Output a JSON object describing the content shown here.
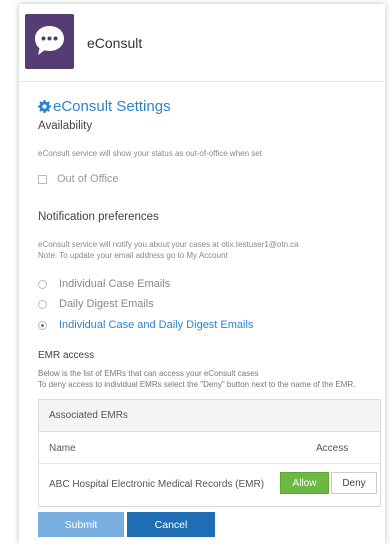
{
  "header": {
    "app_title": "eConsult",
    "logo_icon": "chat-bubble-icon",
    "logo_color": "#553c73"
  },
  "settings": {
    "title": "eConsult Settings",
    "title_icon": "gear-icon",
    "title_color": "#2e84c8"
  },
  "availability": {
    "heading": "Availability",
    "description": "eConsult service will show your status as out-of-office when set",
    "out_of_office_label": "Out of Office",
    "out_of_office_checked": false
  },
  "notifications": {
    "heading": "Notification preferences",
    "description_line1": "eConsult service will notify you about your cases at otix.testuser1@otn.ca",
    "description_line2": "Note: To update your email address go to My Account",
    "options": [
      {
        "label": "Individual Case Emails",
        "selected": false
      },
      {
        "label": "Daily Digest Emails",
        "selected": false
      },
      {
        "label": "Individual Case and Daily Digest Emails",
        "selected": true
      }
    ]
  },
  "emr": {
    "heading": "EMR access",
    "description_line1": "Below is the list of EMRs that can access your eConsult cases",
    "description_line2": "To deny access to individual EMRs select the \"Deny\" button next to the name of the EMR.",
    "table_title": "Associated EMRs",
    "col_name": "Name",
    "col_access": "Access",
    "rows": [
      {
        "name": "ABC Hospital Electronic Medical Records (EMR)",
        "allow_label": "Allow",
        "deny_label": "Deny",
        "access": "Allow"
      }
    ],
    "allow_color": "#6bb842"
  },
  "actions": {
    "submit_label": "Submit",
    "cancel_label": "Cancel",
    "submit_color": "#79aee0",
    "cancel_color": "#1f6db5"
  }
}
